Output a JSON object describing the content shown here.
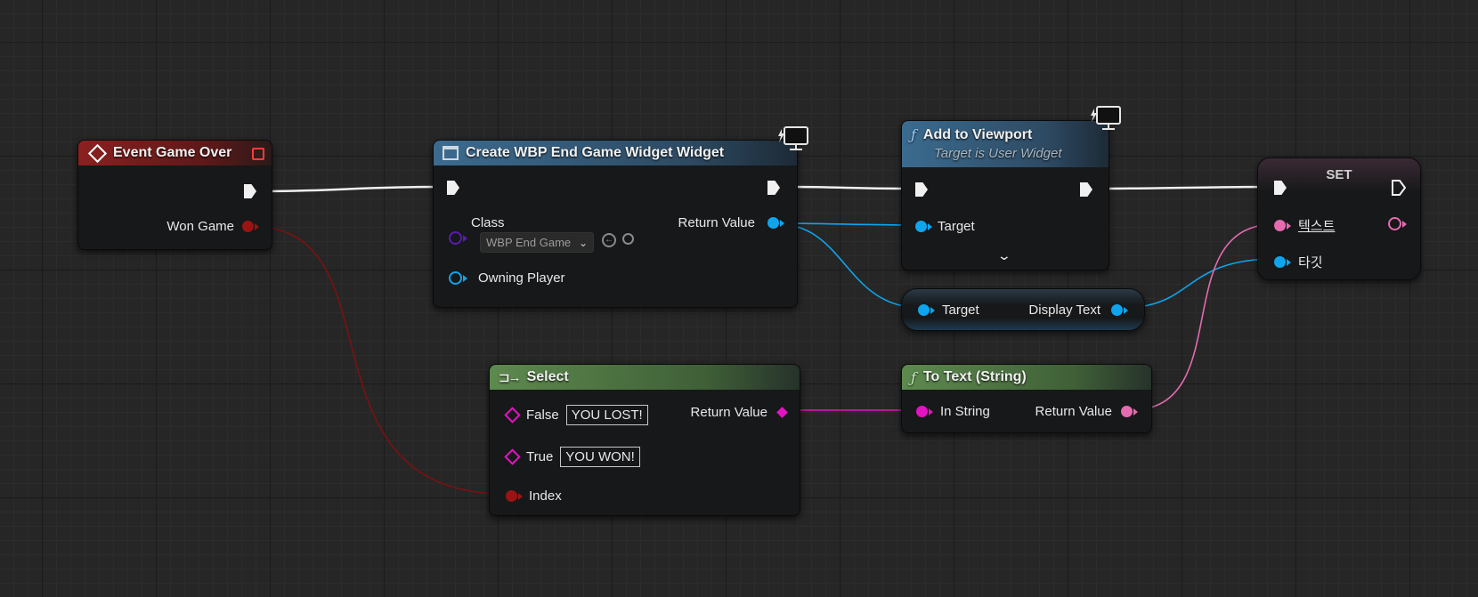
{
  "nodes": {
    "event_game_over": {
      "title": "Event Game Over",
      "won_game_label": "Won Game",
      "colors": {
        "header": "#8b2020",
        "bool_pin": "#9b1414"
      }
    },
    "create_widget": {
      "title": "Create WBP End Game Widget Widget",
      "class_label": "Class",
      "class_value": "WBP End Game",
      "owning_player_label": "Owning Player",
      "return_value_label": "Return Value"
    },
    "add_to_viewport": {
      "title": "Add to Viewport",
      "subtitle": "Target is User Widget",
      "target_label": "Target"
    },
    "display_text_getter": {
      "target_label": "Target",
      "display_text_label": "Display Text"
    },
    "set": {
      "title": "SET",
      "text_label": "텍스트",
      "target_label": "타깃"
    },
    "select": {
      "title": "Select",
      "false_label": "False",
      "false_value": "YOU LOST!",
      "true_label": "True",
      "true_value": "YOU WON!",
      "index_label": "Index",
      "return_value_label": "Return Value"
    },
    "to_text": {
      "title": "To Text (String)",
      "in_string_label": "In String",
      "return_value_label": "Return Value"
    }
  },
  "colors": {
    "exec_wire": "#f0f0f0",
    "object_pin": "#0ea5ee",
    "bool_wire": "#7a1212",
    "string_pin": "#e313c2",
    "text_pin": "#e46bb0"
  },
  "icons": {
    "event": "event-diamond-icon",
    "widget": "widget-icon",
    "function": "function-f-icon",
    "select": "select-icon",
    "network": "monitor-icon"
  }
}
